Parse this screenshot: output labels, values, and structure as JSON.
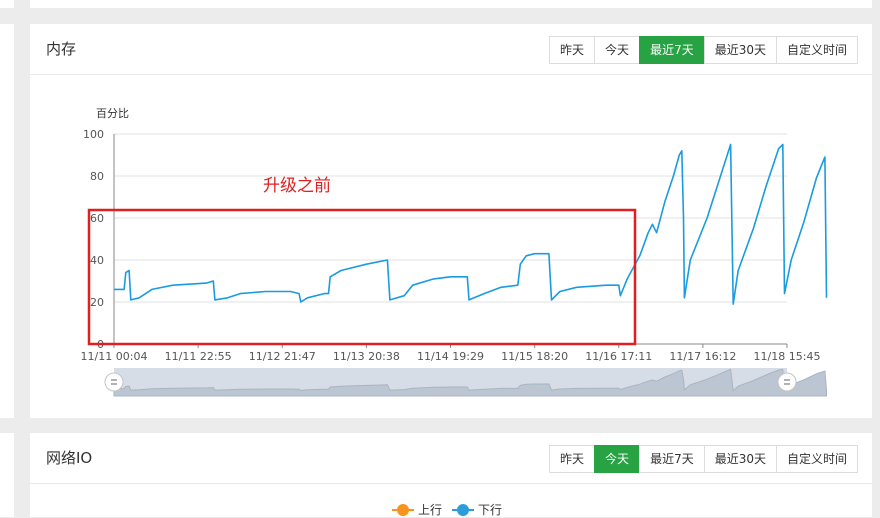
{
  "memory_panel": {
    "title": "内存",
    "range_buttons": [
      "昨天",
      "今天",
      "最近7天",
      "最近30天",
      "自定义时间"
    ],
    "active_range": "最近7天",
    "annotation": "升级之前"
  },
  "network_panel": {
    "title": "网络IO",
    "range_buttons": [
      "昨天",
      "今天",
      "最近7天",
      "最近30天",
      "自定义时间"
    ],
    "active_range": "今天",
    "legend": [
      {
        "name": "上行",
        "color": "#f7931e"
      },
      {
        "name": "下行",
        "color": "#2d9cdb"
      }
    ]
  },
  "colors": {
    "accent_green": "#27a344",
    "series_blue": "#1a9be0",
    "highlight_red": "#e02020"
  },
  "chart_data": {
    "type": "line",
    "ylabel": "百分比",
    "ylim": [
      0,
      100
    ],
    "y_ticks": [
      0,
      20,
      40,
      60,
      80,
      100
    ],
    "x_tick_labels": [
      "11/11 00:04",
      "11/11 22:55",
      "11/12 21:47",
      "11/13 20:38",
      "11/14 19:29",
      "11/15 18:20",
      "11/16 17:11",
      "11/17 16:12",
      "11/18 15:45"
    ],
    "grid": true,
    "series": [
      {
        "values": [
          [
            0,
            26
          ],
          [
            0.12,
            26
          ],
          [
            0.14,
            34
          ],
          [
            0.18,
            35
          ],
          [
            0.2,
            21
          ],
          [
            0.3,
            22
          ],
          [
            0.45,
            26
          ],
          [
            0.7,
            28
          ],
          [
            1.1,
            29
          ],
          [
            1.18,
            30
          ],
          [
            1.2,
            21
          ],
          [
            1.35,
            22
          ],
          [
            1.5,
            24
          ],
          [
            1.8,
            25
          ],
          [
            2.1,
            25
          ],
          [
            2.2,
            24
          ],
          [
            2.22,
            20
          ],
          [
            2.3,
            22
          ],
          [
            2.5,
            24
          ],
          [
            2.55,
            24
          ],
          [
            2.57,
            32
          ],
          [
            2.7,
            35
          ],
          [
            3.0,
            38
          ],
          [
            3.25,
            40
          ],
          [
            3.28,
            21
          ],
          [
            3.45,
            23
          ],
          [
            3.55,
            28
          ],
          [
            3.8,
            31
          ],
          [
            4.0,
            32
          ],
          [
            4.2,
            32
          ],
          [
            4.22,
            21
          ],
          [
            4.4,
            24
          ],
          [
            4.6,
            27
          ],
          [
            4.8,
            28
          ],
          [
            4.83,
            38
          ],
          [
            4.9,
            42
          ],
          [
            5.0,
            43
          ],
          [
            5.17,
            43
          ],
          [
            5.2,
            21
          ],
          [
            5.3,
            25
          ],
          [
            5.5,
            27
          ],
          [
            5.85,
            28
          ],
          [
            6.0,
            28
          ],
          [
            6.02,
            23
          ],
          [
            6.1,
            31
          ],
          [
            6.25,
            42
          ],
          [
            6.35,
            53
          ],
          [
            6.4,
            57
          ],
          [
            6.45,
            53
          ],
          [
            6.55,
            68
          ],
          [
            6.65,
            80
          ],
          [
            6.72,
            90
          ],
          [
            6.75,
            92
          ],
          [
            6.77,
            60
          ],
          [
            6.78,
            22
          ],
          [
            6.85,
            40
          ],
          [
            7.05,
            60
          ],
          [
            7.25,
            85
          ],
          [
            7.33,
            95
          ],
          [
            7.36,
            19
          ],
          [
            7.42,
            35
          ],
          [
            7.6,
            55
          ],
          [
            7.75,
            75
          ],
          [
            7.9,
            93
          ],
          [
            7.95,
            95
          ],
          [
            7.97,
            24
          ],
          [
            8.05,
            40
          ],
          [
            8.2,
            58
          ],
          [
            8.35,
            79
          ],
          [
            8.4,
            84
          ],
          [
            8.45,
            89
          ],
          [
            8.47,
            22
          ]
        ]
      }
    ]
  }
}
